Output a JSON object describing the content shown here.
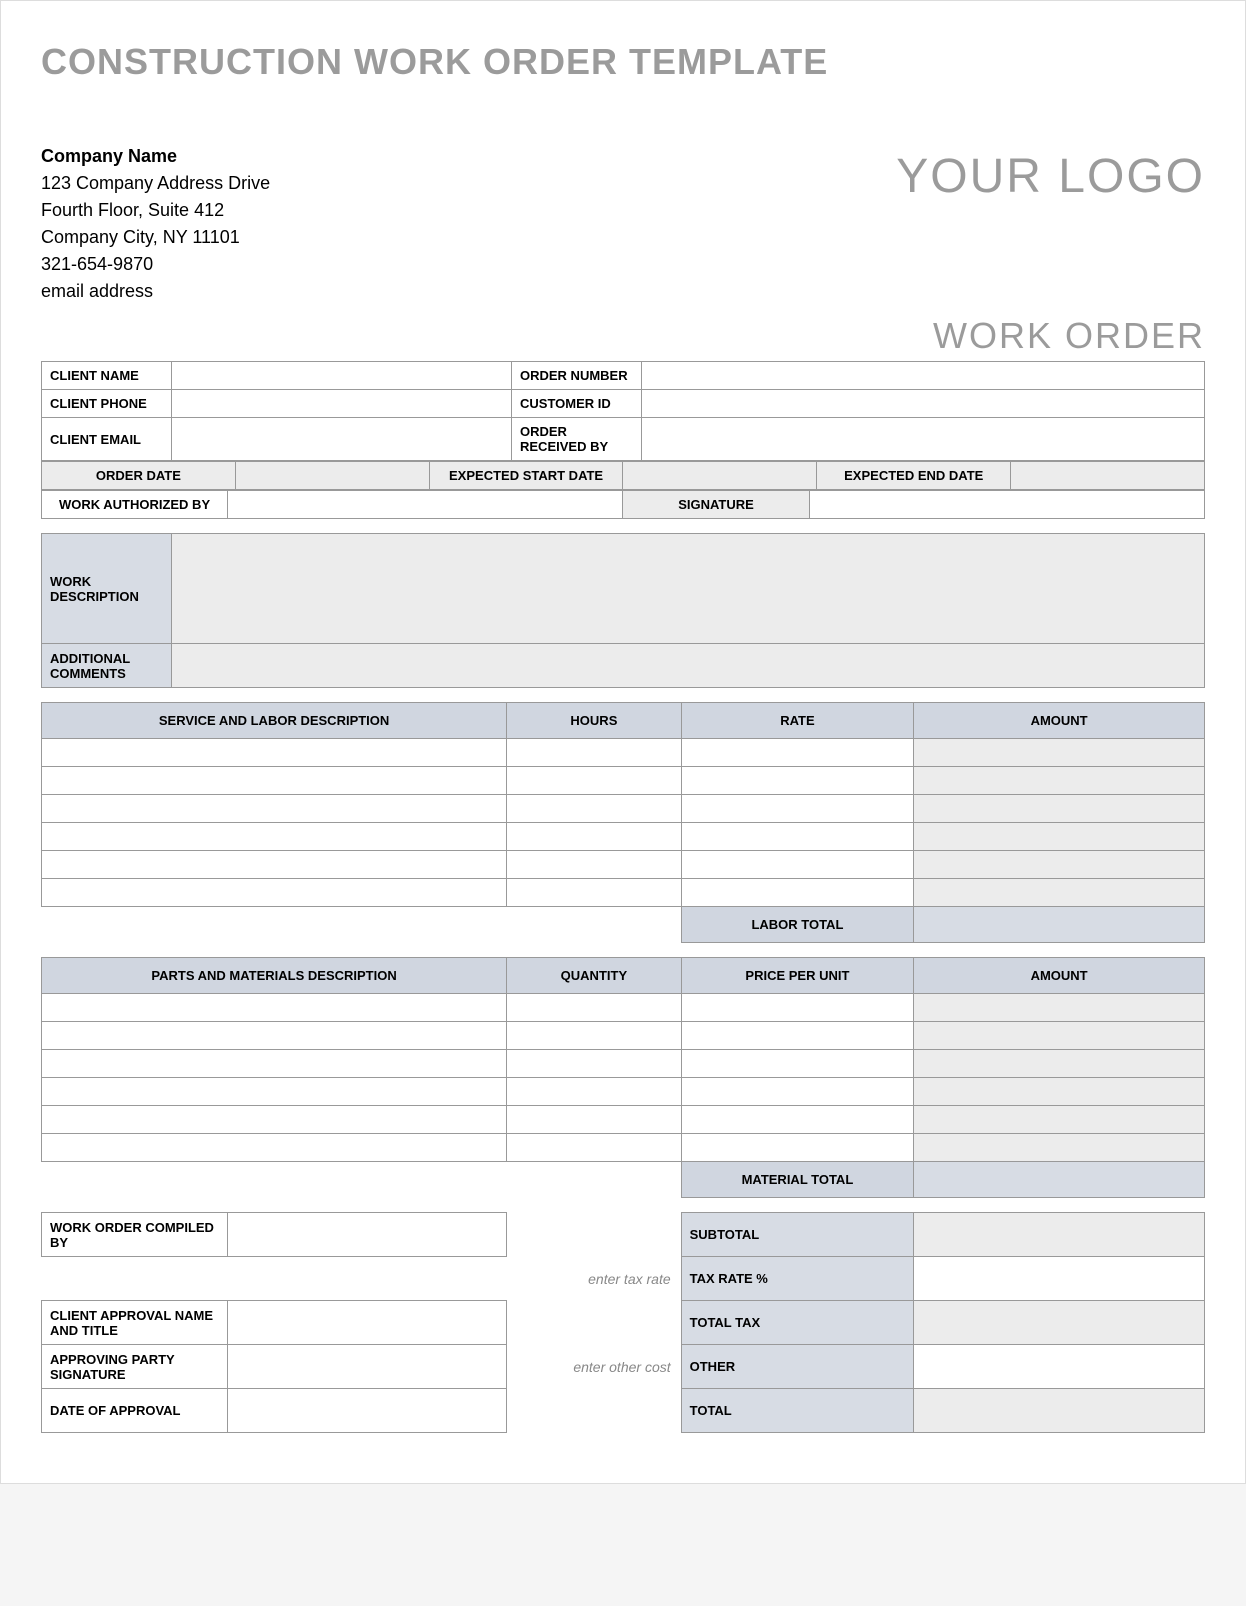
{
  "title": "CONSTRUCTION WORK ORDER TEMPLATE",
  "company": {
    "name": "Company Name",
    "addr1": "123 Company Address Drive",
    "addr2": "Fourth Floor, Suite 412",
    "addr3": "Company City, NY  11101",
    "phone": "321-654-9870",
    "email": "email address"
  },
  "logo_text": "YOUR LOGO",
  "work_order_heading": "WORK ORDER",
  "fields": {
    "client_name": "CLIENT NAME",
    "client_phone": "CLIENT PHONE",
    "client_email": "CLIENT EMAIL",
    "order_number": "ORDER NUMBER",
    "customer_id": "CUSTOMER ID",
    "order_received_by": "ORDER RECEIVED BY",
    "order_date": "ORDER DATE",
    "expected_start": "EXPECTED START DATE",
    "expected_end": "EXPECTED END DATE",
    "work_auth_by": "WORK AUTHORIZED BY",
    "signature": "SIGNATURE",
    "work_desc": "WORK DESCRIPTION",
    "addl_comments": "ADDITIONAL COMMENTS"
  },
  "service_table": {
    "h_desc": "SERVICE AND LABOR DESCRIPTION",
    "h_hours": "HOURS",
    "h_rate": "RATE",
    "h_amount": "AMOUNT",
    "labor_total": "LABOR TOTAL"
  },
  "parts_table": {
    "h_desc": "PARTS AND MATERIALS DESCRIPTION",
    "h_qty": "QUANTITY",
    "h_price": "PRICE PER UNIT",
    "h_amount": "AMOUNT",
    "material_total": "MATERIAL TOTAL"
  },
  "bottom": {
    "compiled_by": "WORK ORDER COMPILED BY",
    "client_approval": "CLIENT APPROVAL NAME AND TITLE",
    "approving_sig": "APPROVING PARTY SIGNATURE",
    "approval_date": "DATE OF APPROVAL",
    "hint_tax": "enter tax rate",
    "hint_other": "enter other cost",
    "subtotal": "SUBTOTAL",
    "tax_rate": "TAX RATE %",
    "total_tax": "TOTAL TAX",
    "other": "OTHER",
    "total": "TOTAL"
  }
}
